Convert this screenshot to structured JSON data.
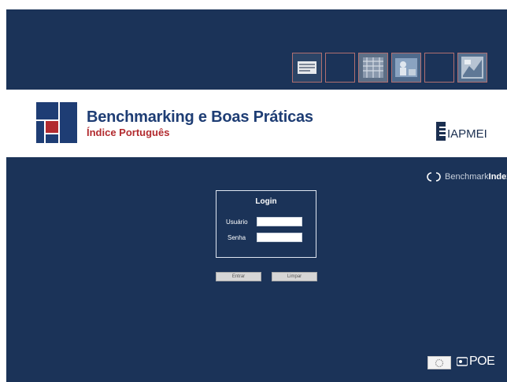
{
  "header": {
    "thumbnails": [
      {
        "icon": "document-photo-icon"
      },
      {
        "icon": "empty-thumb-icon"
      },
      {
        "icon": "texture-photo-icon"
      },
      {
        "icon": "workers-photo-icon"
      },
      {
        "icon": "empty-thumb-icon"
      },
      {
        "icon": "industry-photo-icon"
      }
    ]
  },
  "brand": {
    "title": "Benchmarking e Boas Práticas",
    "subtitle": "Índice Português",
    "partner": "IAPMEI"
  },
  "main": {
    "benchmark_light": "Benchmark",
    "benchmark_bold": "Index",
    "login": {
      "title": "Login",
      "user_label": "Usuário",
      "user_value": "",
      "password_label": "Senha",
      "password_value": ""
    },
    "buttons": {
      "submit": "Entrar",
      "clear": "Limpar"
    },
    "footer_logo": "POE"
  },
  "colors": {
    "navy": "#1b3358",
    "brand_blue": "#1e3d74",
    "brand_red": "#b22b2f"
  }
}
